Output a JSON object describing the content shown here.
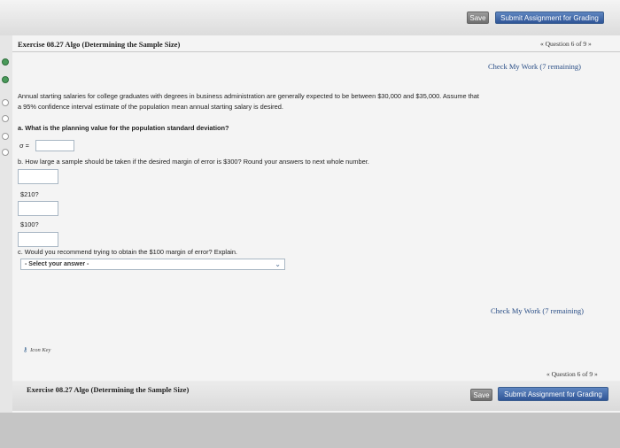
{
  "toolbar": {
    "save_label": "Save",
    "submit_label": "Submit Assignment for Grading"
  },
  "header": {
    "title": "Exercise 08.27 Algo (Determining the Sample Size)",
    "question_nav": "« Question 6 of 9 »",
    "check_work": "Check My Work (7 remaining)"
  },
  "question": {
    "intro_line1": "Annual starting salaries for college graduates with degrees in business administration are generally expected to be between $30,000 and $35,000. Assume that",
    "intro_line2": "a 95% confidence interval estimate of the population mean annual starting salary is desired.",
    "part_a": "a. What is the planning value for the population standard deviation?",
    "sigma_label": "σ =",
    "part_b": "b. How large a sample should be taken if the desired margin of error is $300? Round your answers to next whole number.",
    "margin1": "$210?",
    "margin2": "$100?",
    "part_c": "c. Would you recommend trying to obtain the $100 margin of error? Explain.",
    "select_value": "- Select your answer -"
  },
  "footer_section": {
    "check_work": "Check My Work (7 remaining)",
    "icon_key": "Icon Key",
    "title": "Exercise 08.27 Algo (Determining the Sample Size)",
    "question_nav": "« Question 6 of 9 »"
  }
}
